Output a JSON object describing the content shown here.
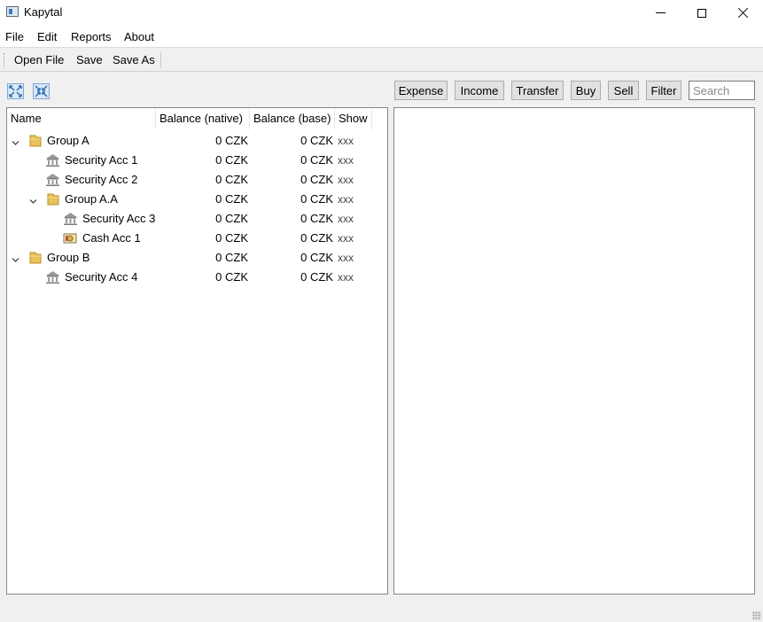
{
  "window": {
    "title": "Kapytal",
    "icon": "app-icon",
    "controls": [
      "minimize-icon",
      "maximize-icon",
      "close-icon"
    ]
  },
  "menu": [
    "File",
    "Edit",
    "Reports",
    "About"
  ],
  "toolbar": {
    "open_file": "Open File",
    "save": "Save",
    "save_as": "Save As"
  },
  "tree_tools": [
    "expand-all-icon",
    "collapse-all-icon"
  ],
  "actions": {
    "expense": "Expense",
    "income": "Income",
    "transfer": "Transfer",
    "buy": "Buy",
    "sell": "Sell",
    "filter": "Filter",
    "search_placeholder": "Search"
  },
  "tree": {
    "columns": [
      "Name",
      "Balance (native)",
      "Balance (base)",
      "Show"
    ],
    "rows": [
      {
        "name": "Group A",
        "native": "0 CZK",
        "base": "0 CZK",
        "show": "xxx",
        "icon": "folder-icon",
        "expanded": true
      },
      {
        "name": "Security Acc 1",
        "native": "0 CZK",
        "base": "0 CZK",
        "show": "xxx",
        "icon": "bank-icon"
      },
      {
        "name": "Security Acc 2",
        "native": "0 CZK",
        "base": "0 CZK",
        "show": "xxx",
        "icon": "bank-icon"
      },
      {
        "name": "Group A.A",
        "native": "0 CZK",
        "base": "0 CZK",
        "show": "xxx",
        "icon": "folder-icon",
        "expanded": true
      },
      {
        "name": "Security Acc 3",
        "native": "0 CZK",
        "base": "0 CZK",
        "show": "xxx",
        "icon": "bank-icon"
      },
      {
        "name": "Cash Acc 1",
        "native": "0 CZK",
        "base": "0 CZK",
        "show": "xxx",
        "icon": "cash-icon"
      },
      {
        "name": "Group B",
        "native": "0 CZK",
        "base": "0 CZK",
        "show": "xxx",
        "icon": "folder-icon",
        "expanded": true
      },
      {
        "name": "Security Acc 4",
        "native": "0 CZK",
        "base": "0 CZK",
        "show": "xxx",
        "icon": "bank-icon"
      }
    ]
  }
}
